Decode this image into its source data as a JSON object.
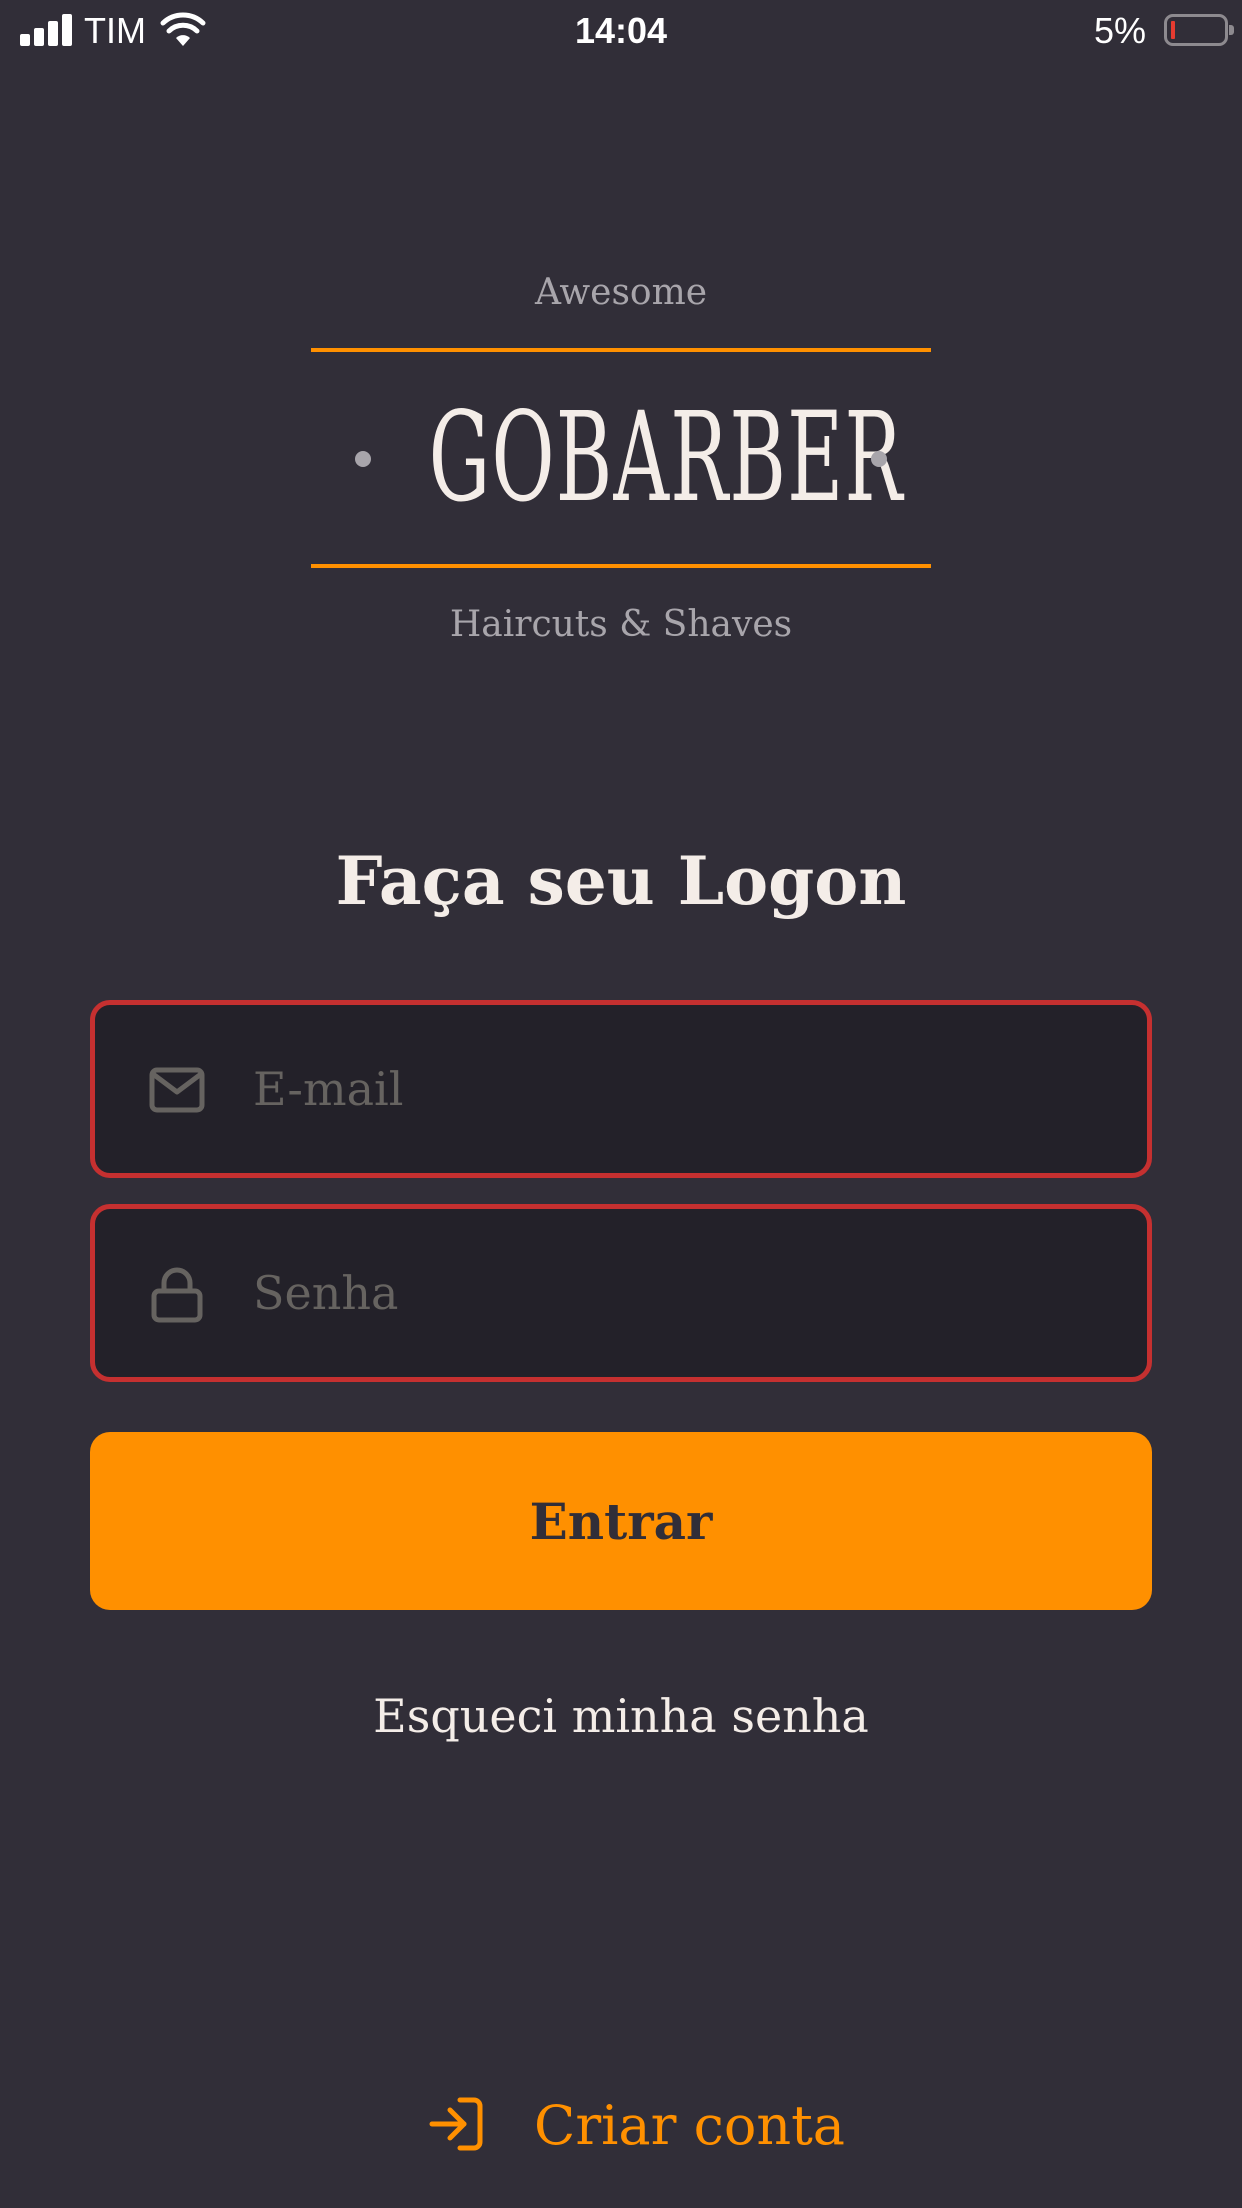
{
  "status_bar": {
    "carrier": "TIM",
    "time": "14:04",
    "battery_percent": "5%",
    "battery_level": 0.05,
    "signal_bars": 4,
    "icons": [
      "signal-icon",
      "wifi-icon",
      "battery-icon"
    ]
  },
  "logo": {
    "top_text": "Awesome",
    "name": "GOBARBER",
    "bottom_text": "Haircuts & Shaves",
    "accent_color": "#ff9000"
  },
  "login": {
    "title": "Faça seu Logon",
    "email": {
      "icon": "mail-icon",
      "placeholder": "E-mail",
      "value": ""
    },
    "password": {
      "icon": "lock-icon",
      "placeholder": "Senha",
      "value": ""
    },
    "error_border_color": "#c53030",
    "submit_label": "Entrar",
    "forgot_password_label": "Esqueci minha senha"
  },
  "footer": {
    "create_account_icon": "log-in-icon",
    "create_account_label": "Criar conta"
  },
  "colors": {
    "background": "#312e38",
    "input_background": "#232129",
    "primary": "#ff9000",
    "text": "#f4ede8",
    "muted": "#666360"
  }
}
